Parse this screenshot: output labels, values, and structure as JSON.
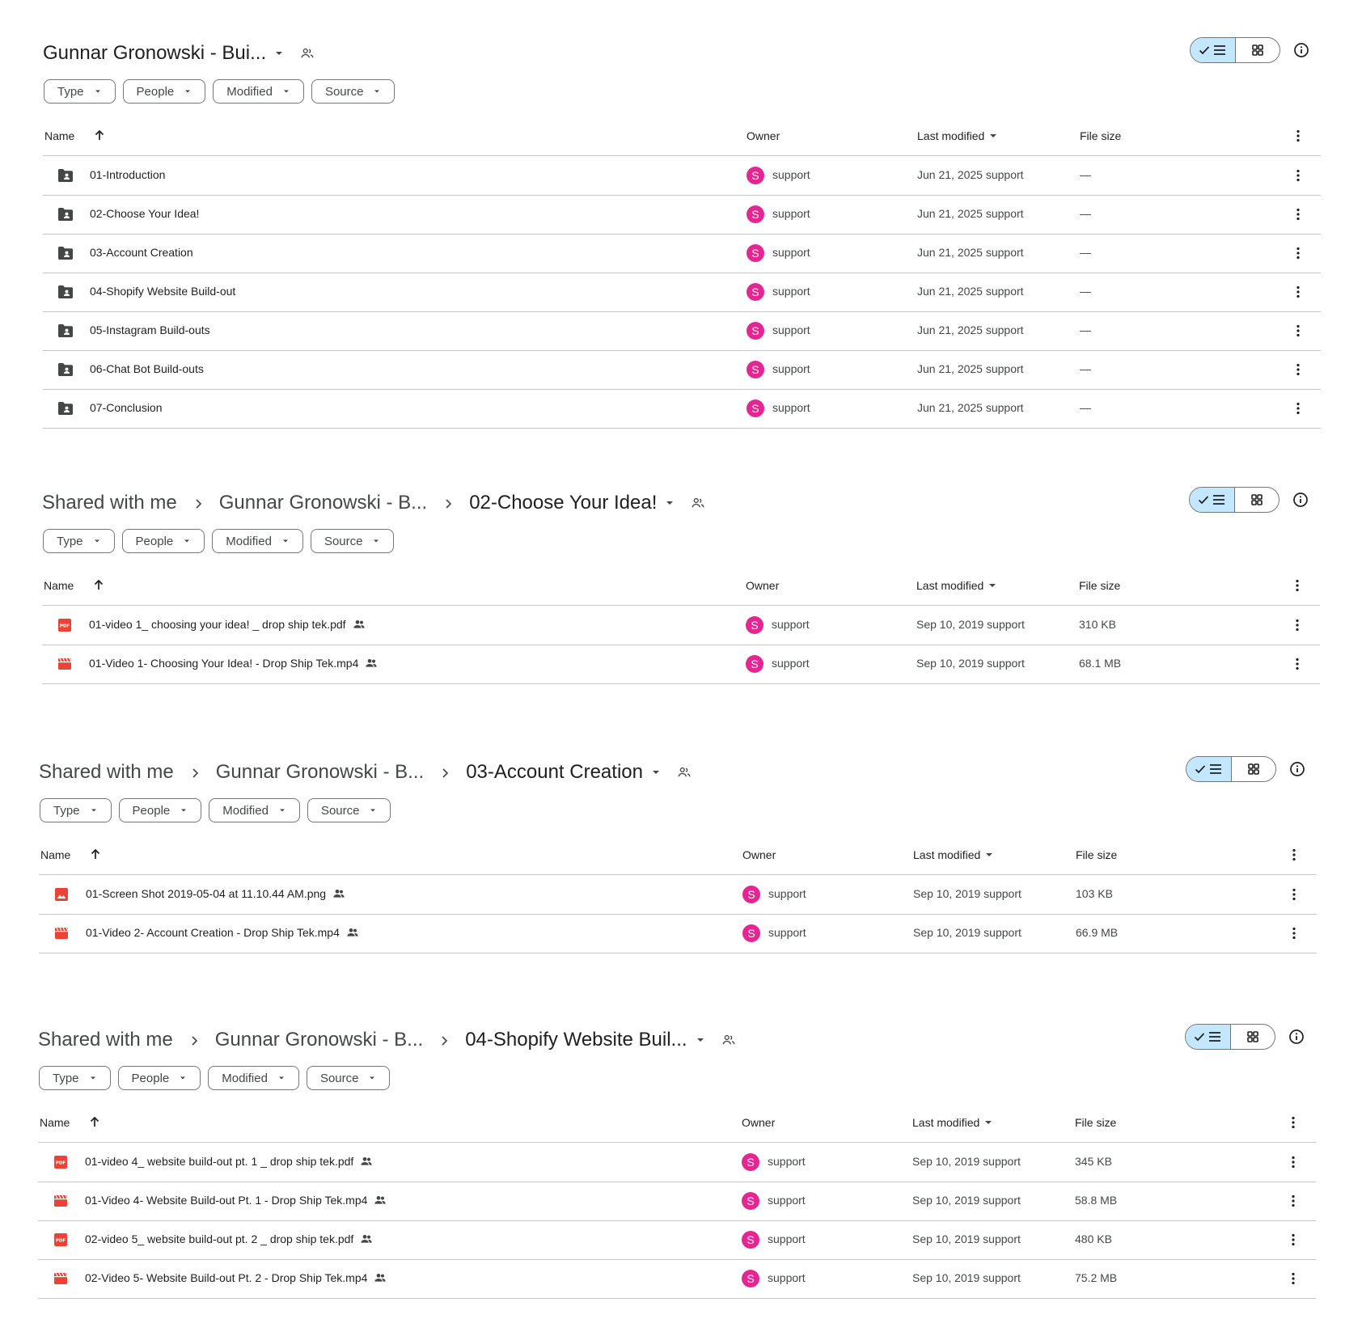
{
  "filters": {
    "type": "Type",
    "people": "People",
    "modified": "Modified",
    "source": "Source"
  },
  "headers": {
    "name": "Name",
    "owner": "Owner",
    "last_modified": "Last modified",
    "file_size": "File size"
  },
  "colors": {
    "accent_toggle": "#c2e7ff",
    "avatar": "#e52592",
    "file_red": "#ea4335",
    "folder": "#444746"
  },
  "panels": [
    {
      "crumbs": [
        {
          "label": "Gunnar Gronowski - Bui..."
        }
      ],
      "rows": [
        {
          "icon": "shared-folder-icon",
          "name": "01-Introduction",
          "owner_initial": "S",
          "owner": "support",
          "modified": "Jun 21, 2025 support",
          "size": "—"
        },
        {
          "icon": "shared-folder-icon",
          "name": "02-Choose Your Idea!",
          "owner_initial": "S",
          "owner": "support",
          "modified": "Jun 21, 2025 support",
          "size": "—"
        },
        {
          "icon": "shared-folder-icon",
          "name": "03-Account Creation",
          "owner_initial": "S",
          "owner": "support",
          "modified": "Jun 21, 2025 support",
          "size": "—"
        },
        {
          "icon": "shared-folder-icon",
          "name": "04-Shopify Website Build-out",
          "owner_initial": "S",
          "owner": "support",
          "modified": "Jun 21, 2025 support",
          "size": "—"
        },
        {
          "icon": "shared-folder-icon",
          "name": "05-Instagram Build-outs",
          "owner_initial": "S",
          "owner": "support",
          "modified": "Jun 21, 2025 support",
          "size": "—"
        },
        {
          "icon": "shared-folder-icon",
          "name": "06-Chat Bot Build-outs",
          "owner_initial": "S",
          "owner": "support",
          "modified": "Jun 21, 2025 support",
          "size": "—"
        },
        {
          "icon": "shared-folder-icon",
          "name": "07-Conclusion",
          "owner_initial": "S",
          "owner": "support",
          "modified": "Jun 21, 2025 support",
          "size": "—"
        }
      ]
    },
    {
      "crumbs": [
        {
          "label": "Shared with me"
        },
        {
          "label": "Gunnar Gronowski - B..."
        },
        {
          "label": "02-Choose Your Idea!"
        }
      ],
      "rows": [
        {
          "icon": "pdf-icon",
          "name": "01-video 1_ choosing your idea! _ drop ship tek.pdf",
          "owner_initial": "S",
          "owner": "support",
          "modified": "Sep 10, 2019 support",
          "size": "310 KB"
        },
        {
          "icon": "video-icon",
          "name": "01-Video 1- Choosing Your Idea! - Drop Ship Tek.mp4",
          "owner_initial": "S",
          "owner": "support",
          "modified": "Sep 10, 2019 support",
          "size": "68.1 MB"
        }
      ]
    },
    {
      "crumbs": [
        {
          "label": "Shared with me"
        },
        {
          "label": "Gunnar Gronowski - B..."
        },
        {
          "label": "03-Account Creation"
        }
      ],
      "rows": [
        {
          "icon": "image-icon",
          "name": "01-Screen Shot 2019-05-04 at 11.10.44 AM.png",
          "owner_initial": "S",
          "owner": "support",
          "modified": "Sep 10, 2019 support",
          "size": "103 KB"
        },
        {
          "icon": "video-icon",
          "name": "01-Video 2- Account Creation - Drop Ship Tek.mp4",
          "owner_initial": "S",
          "owner": "support",
          "modified": "Sep 10, 2019 support",
          "size": "66.9 MB"
        }
      ]
    },
    {
      "crumbs": [
        {
          "label": "Shared with me"
        },
        {
          "label": "Gunnar Gronowski - B..."
        },
        {
          "label": "04-Shopify Website Buil..."
        }
      ],
      "rows": [
        {
          "icon": "pdf-icon",
          "name": "01-video 4_ website build-out pt. 1 _ drop ship tek.pdf",
          "owner_initial": "S",
          "owner": "support",
          "modified": "Sep 10, 2019 support",
          "size": "345 KB"
        },
        {
          "icon": "video-icon",
          "name": "01-Video 4- Website Build-out Pt. 1 - Drop Ship Tek.mp4",
          "owner_initial": "S",
          "owner": "support",
          "modified": "Sep 10, 2019 support",
          "size": "58.8 MB"
        },
        {
          "icon": "pdf-icon",
          "name": "02-video 5_ website build-out pt. 2 _ drop ship tek.pdf",
          "owner_initial": "S",
          "owner": "support",
          "modified": "Sep 10, 2019 support",
          "size": "480 KB"
        },
        {
          "icon": "video-icon",
          "name": "02-Video 5- Website Build-out Pt. 2 - Drop Ship Tek.mp4",
          "owner_initial": "S",
          "owner": "support",
          "modified": "Sep 10, 2019 support",
          "size": "75.2 MB"
        }
      ]
    }
  ]
}
